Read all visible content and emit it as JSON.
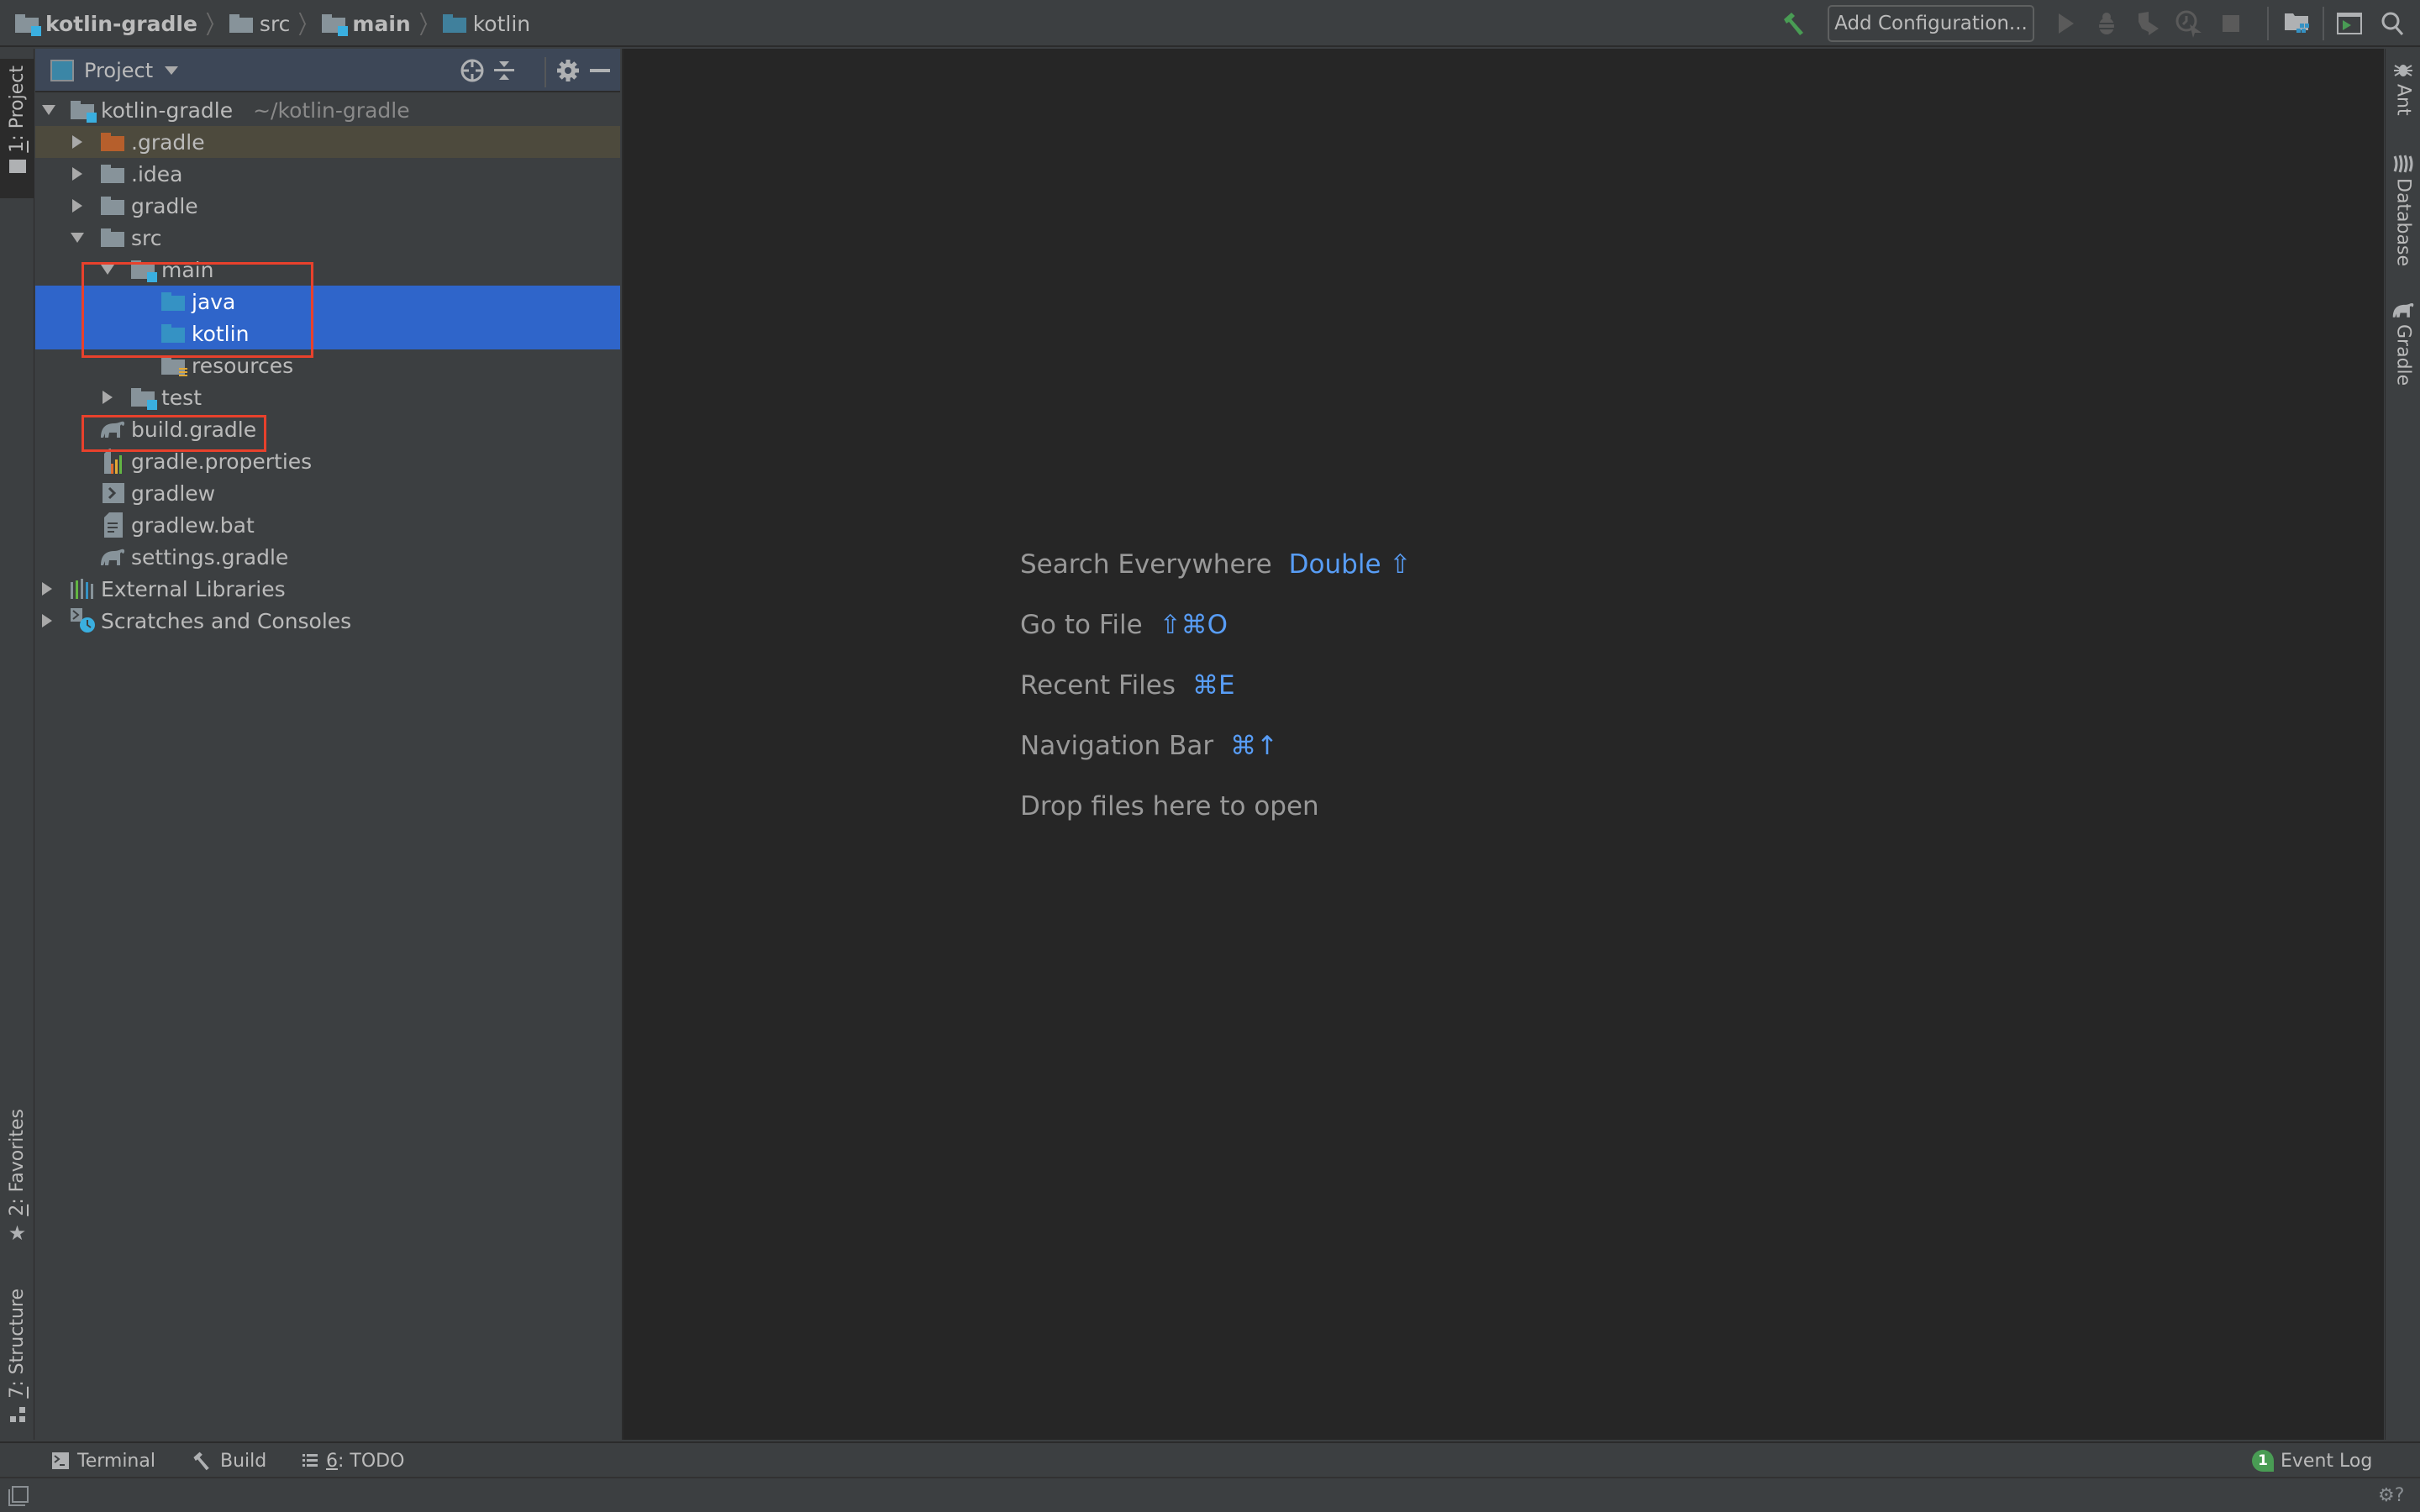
{
  "navbar": {
    "breadcrumbs": [
      {
        "label": "kotlin-gradle",
        "icon": "module-folder-icon",
        "bold": true
      },
      {
        "label": "src",
        "icon": "folder-icon",
        "bold": false
      },
      {
        "label": "main",
        "icon": "module-folder-icon",
        "bold": true
      },
      {
        "label": "kotlin",
        "icon": "source-folder-icon",
        "bold": false
      }
    ],
    "add_configuration_label": "Add Configuration...",
    "toolbar_icons": [
      "build-hammer-icon",
      "run-icon",
      "debug-icon",
      "coverage-icon",
      "profile-icon",
      "stop-icon",
      "project-structure-icon",
      "run-anything-icon",
      "search-icon"
    ]
  },
  "left_stripe": {
    "project_tab": {
      "number": "1",
      "label": ": Project"
    },
    "favorites_tab": {
      "number": "2",
      "label": ": Favorites"
    },
    "structure_tab": {
      "number": "7",
      "label": ": Structure"
    }
  },
  "right_stripe": {
    "tabs": [
      "Ant",
      "Database",
      "Gradle"
    ]
  },
  "project_panel": {
    "title": "Project",
    "header_icons": [
      "locate-icon",
      "collapse-all-icon",
      "settings-gear-icon",
      "hide-icon"
    ],
    "tree": [
      {
        "label": "kotlin-gradle",
        "hint": "~/kotlin-gradle",
        "depth": 0,
        "arrow": "down",
        "icon": "module-folder",
        "state": ""
      },
      {
        "label": ".gradle",
        "depth": 1,
        "arrow": "right",
        "icon": "excluded-folder",
        "state": "excluded"
      },
      {
        "label": ".idea",
        "depth": 1,
        "arrow": "right",
        "icon": "folder",
        "state": ""
      },
      {
        "label": "gradle",
        "depth": 1,
        "arrow": "right",
        "icon": "folder",
        "state": ""
      },
      {
        "label": "src",
        "depth": 1,
        "arrow": "down",
        "icon": "folder",
        "state": ""
      },
      {
        "label": "main",
        "depth": 2,
        "arrow": "down",
        "icon": "module-folder",
        "state": ""
      },
      {
        "label": "java",
        "depth": 3,
        "arrow": "",
        "icon": "source-folder",
        "state": "selected"
      },
      {
        "label": "kotlin",
        "depth": 3,
        "arrow": "",
        "icon": "source-folder",
        "state": "selected"
      },
      {
        "label": "resources",
        "depth": 3,
        "arrow": "",
        "icon": "resources-folder",
        "state": ""
      },
      {
        "label": "test",
        "depth": 2,
        "arrow": "right",
        "icon": "test-folder",
        "state": ""
      },
      {
        "label": "build.gradle",
        "depth": 1,
        "arrow": "",
        "icon": "gradle-file",
        "state": ""
      },
      {
        "label": "gradle.properties",
        "depth": 1,
        "arrow": "",
        "icon": "properties-file",
        "state": ""
      },
      {
        "label": "gradlew",
        "depth": 1,
        "arrow": "",
        "icon": "shell-script-file",
        "state": ""
      },
      {
        "label": "gradlew.bat",
        "depth": 1,
        "arrow": "",
        "icon": "text-file",
        "state": ""
      },
      {
        "label": "settings.gradle",
        "depth": 1,
        "arrow": "",
        "icon": "gradle-file",
        "state": ""
      },
      {
        "label": "External Libraries",
        "depth": 0,
        "arrow": "right",
        "icon": "libraries",
        "state": ""
      },
      {
        "label": "Scratches and Consoles",
        "depth": 0,
        "arrow": "right",
        "icon": "scratches",
        "state": ""
      }
    ]
  },
  "editor": {
    "empty_hints": [
      {
        "label": "Search Everywhere",
        "shortcut": "Double ⇧"
      },
      {
        "label": "Go to File",
        "shortcut": "⇧⌘O"
      },
      {
        "label": "Recent Files",
        "shortcut": "⌘E"
      },
      {
        "label": "Navigation Bar",
        "shortcut": "⌘↑"
      },
      {
        "label": "Drop files here to open",
        "shortcut": ""
      }
    ]
  },
  "bottom_toolbar": {
    "terminal": "Terminal",
    "build": "Build",
    "todo_number": "6",
    "todo_label": ": TODO",
    "event_log_count": "1",
    "event_log": "Event Log"
  },
  "colors": {
    "selection": "#2f65ca",
    "shortcut_blue": "#589df6",
    "annotation_red": "#e8412c",
    "run_green": "#499c54"
  }
}
